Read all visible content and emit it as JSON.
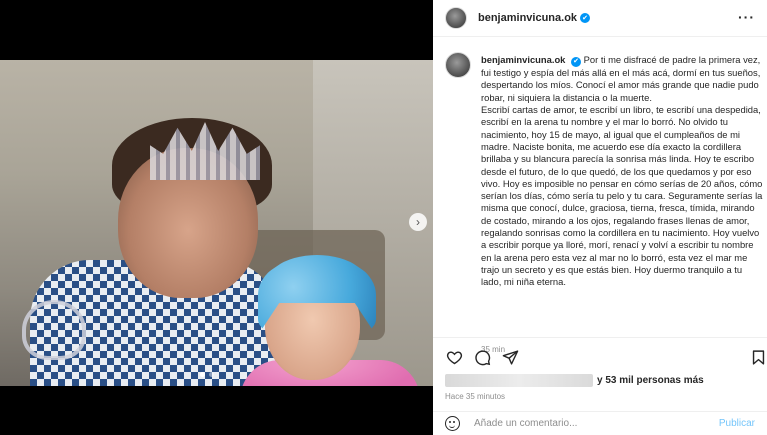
{
  "post": {
    "username": "benjaminvicuna.ok",
    "verified_mark": "✔",
    "more_label": "···",
    "caption_paragraphs": [
      "Por ti me disfracé de padre la primera vez, fui testigo y espía del más allá en el más acá, dormí en tus sueños, despertando los míos. Conocí el amor más grande que nadie pudo robar, ni siquiera la distancia o la muerte.",
      "Escribí cartas de amor, te escribí un libro, te escribí una despedida, escribí en la arena tu nombre y el mar lo borró. No olvido tu nacimiento, hoy 15 de mayo, al igual que el cumpleaños de mi madre. Naciste bonita, me acuerdo ese día exacto la cordillera brillaba y su blancura parecía la sonrisa más linda. Hoy te escribo desde el futuro, de lo que quedó, de los que quedamos y por eso vivo. Hoy es imposible no pensar en cómo serías de 20 años, cómo serían los días, cómo sería tu pelo y tu cara. Seguramente serías la misma que conocí, dulce, graciosa, tierna, fresca, tímida, mirando de costado, mirando a los ojos, regalando frases llenas de amor, regalando sonrisas como la cordillera en tu nacimiento. Hoy vuelvo a escribir porque ya lloré, morí, renací y volví a escribir tu nombre en la arena pero esta vez al mar no lo borró, esta vez el mar me trajo un secreto y es que estás bien. Hoy duermo tranquilo a tu lado, mi niña eterna."
    ],
    "caption_time": "35 min",
    "likes_text": "y 53 mil personas más",
    "time_ago": "Hace 35 minutos"
  },
  "comment": {
    "placeholder": "Añade un comentario...",
    "publish_label": "Publicar"
  },
  "carousel": {
    "next_glyph": "›",
    "slide_count": 2,
    "active_slide": 1
  },
  "icons": {
    "like": "heart-icon",
    "comment": "comment-icon",
    "share": "share-icon",
    "save": "bookmark-icon",
    "emoji": "emoji-icon",
    "more": "more-options-icon"
  },
  "colors": {
    "verified": "#0095f6",
    "publish": "#0095f6",
    "muted_text": "#8e8e8e"
  }
}
